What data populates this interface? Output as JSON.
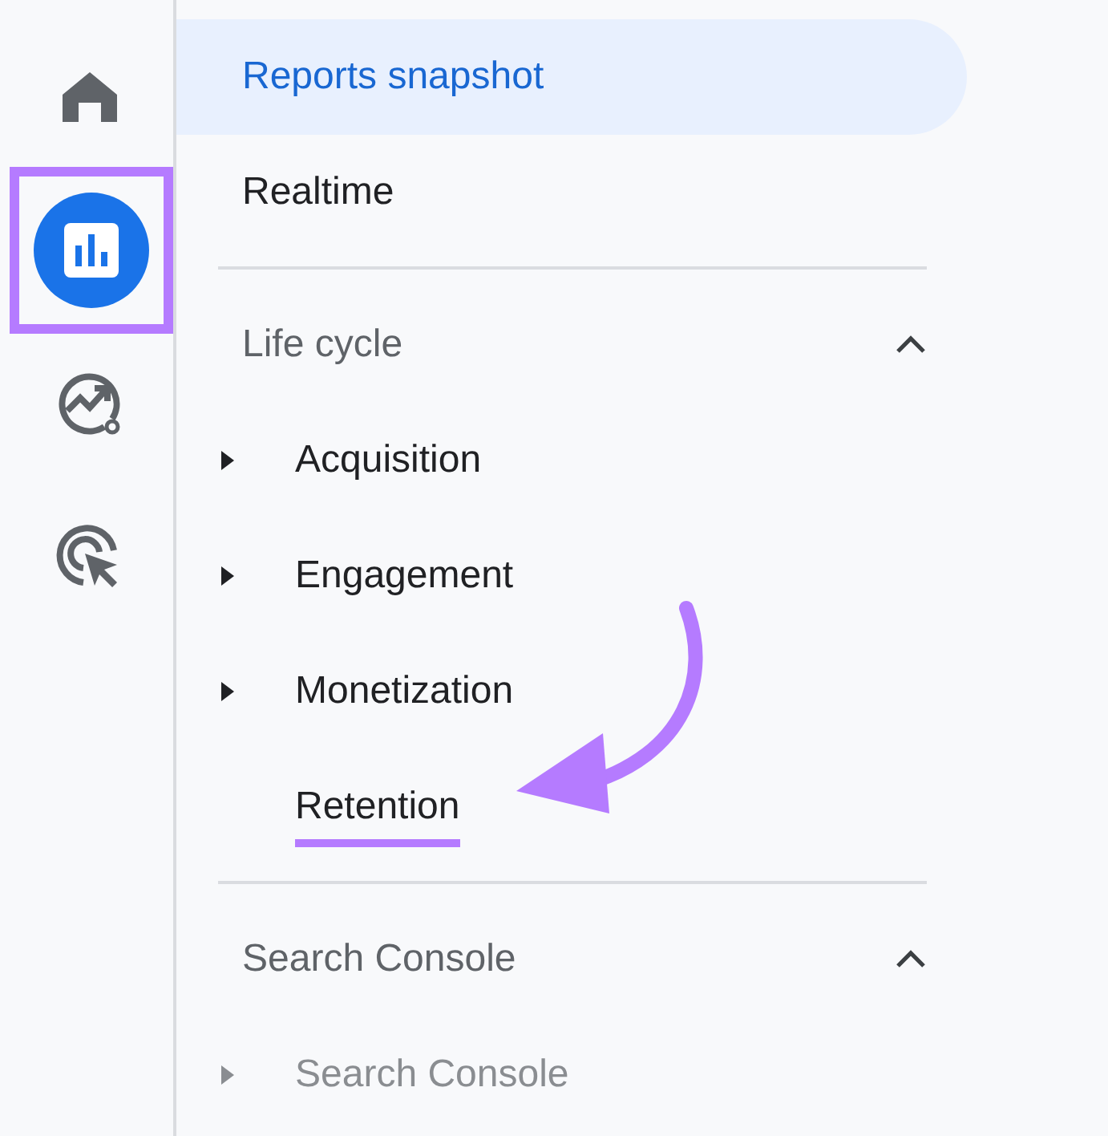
{
  "rail": [
    {
      "kind": "home",
      "selected": false,
      "highlighted": false
    },
    {
      "kind": "reports",
      "selected": true,
      "highlighted": true
    },
    {
      "kind": "explore",
      "selected": false,
      "highlighted": false
    },
    {
      "kind": "advertising",
      "selected": false,
      "highlighted": false
    }
  ],
  "nav": {
    "items": [
      {
        "label": "Reports snapshot",
        "selected": true
      },
      {
        "label": "Realtime",
        "selected": false
      }
    ],
    "sections": [
      {
        "title": "Life cycle",
        "expanded": true,
        "items": [
          {
            "label": "Acquisition",
            "expandable": true,
            "highlighted": false,
            "faded": false
          },
          {
            "label": "Engagement",
            "expandable": true,
            "highlighted": false,
            "faded": false
          },
          {
            "label": "Monetization",
            "expandable": true,
            "highlighted": false,
            "faded": false
          },
          {
            "label": "Retention",
            "expandable": false,
            "highlighted": true,
            "faded": false
          }
        ]
      },
      {
        "title": "Search Console",
        "expanded": true,
        "items": [
          {
            "label": "Search Console",
            "expandable": true,
            "highlighted": false,
            "faded": true
          }
        ]
      }
    ]
  }
}
